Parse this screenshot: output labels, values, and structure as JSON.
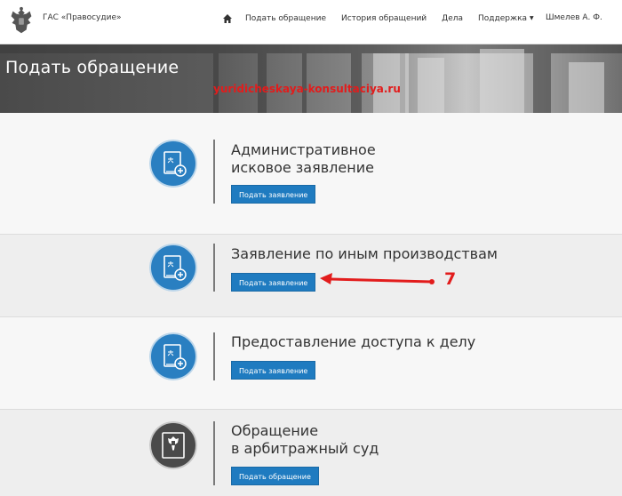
{
  "header": {
    "brand": "ГАС «Правосудие»",
    "nav": {
      "home_icon": "home-icon",
      "items": [
        "Подать обращение",
        "История обращений",
        "Дела",
        "Поддержка"
      ]
    },
    "user": "Шмелев А. Ф."
  },
  "banner": {
    "title": "Подать обращение",
    "watermark": "yuridicheskaya-konsultaciya.ru"
  },
  "cards": [
    {
      "title": [
        "Административное",
        "исковое заявление"
      ],
      "button": "Подать заявление",
      "icon": "document-plus-icon"
    },
    {
      "title": [
        "Заявление по иным производствам"
      ],
      "button": "Подать заявление",
      "icon": "document-plus-icon"
    },
    {
      "title": [
        "Предоставление доступа к делу"
      ],
      "button": "Подать заявление",
      "icon": "document-plus-icon"
    },
    {
      "title": [
        "Обращение",
        "в арбитражный суд"
      ],
      "button": "Подать обращение",
      "icon": "coat-of-arms-icon"
    }
  ],
  "annotation": {
    "step": "7"
  },
  "colors": {
    "accent": "#1f7bc0",
    "icon_blue": "#2a7fc1",
    "icon_dark": "#4a4a4a",
    "annotation_red": "#e21c1c"
  }
}
